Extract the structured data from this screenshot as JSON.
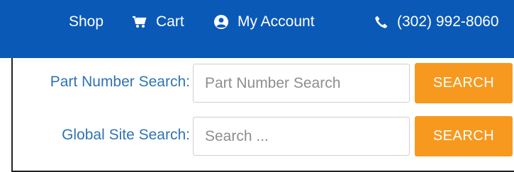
{
  "header": {
    "nav": {
      "shop_label": "Shop",
      "cart_label": "Cart",
      "account_label": "My Account",
      "phone_label": "(302) 992-8060"
    },
    "background_color": "#0a59b7"
  },
  "part_search": {
    "label": "Part Number Search:",
    "placeholder": "Part Number Search",
    "value": "",
    "button_label": "SEARCH"
  },
  "site_search": {
    "label": "Global Site Search:",
    "placeholder": "Search ...",
    "value": "",
    "button_label": "SEARCH"
  },
  "colors": {
    "accent": "#f7991e",
    "label_text": "#2f73b3"
  },
  "icons": {
    "cart": "cart-icon",
    "account": "user-circle-icon",
    "phone": "phone-icon"
  }
}
